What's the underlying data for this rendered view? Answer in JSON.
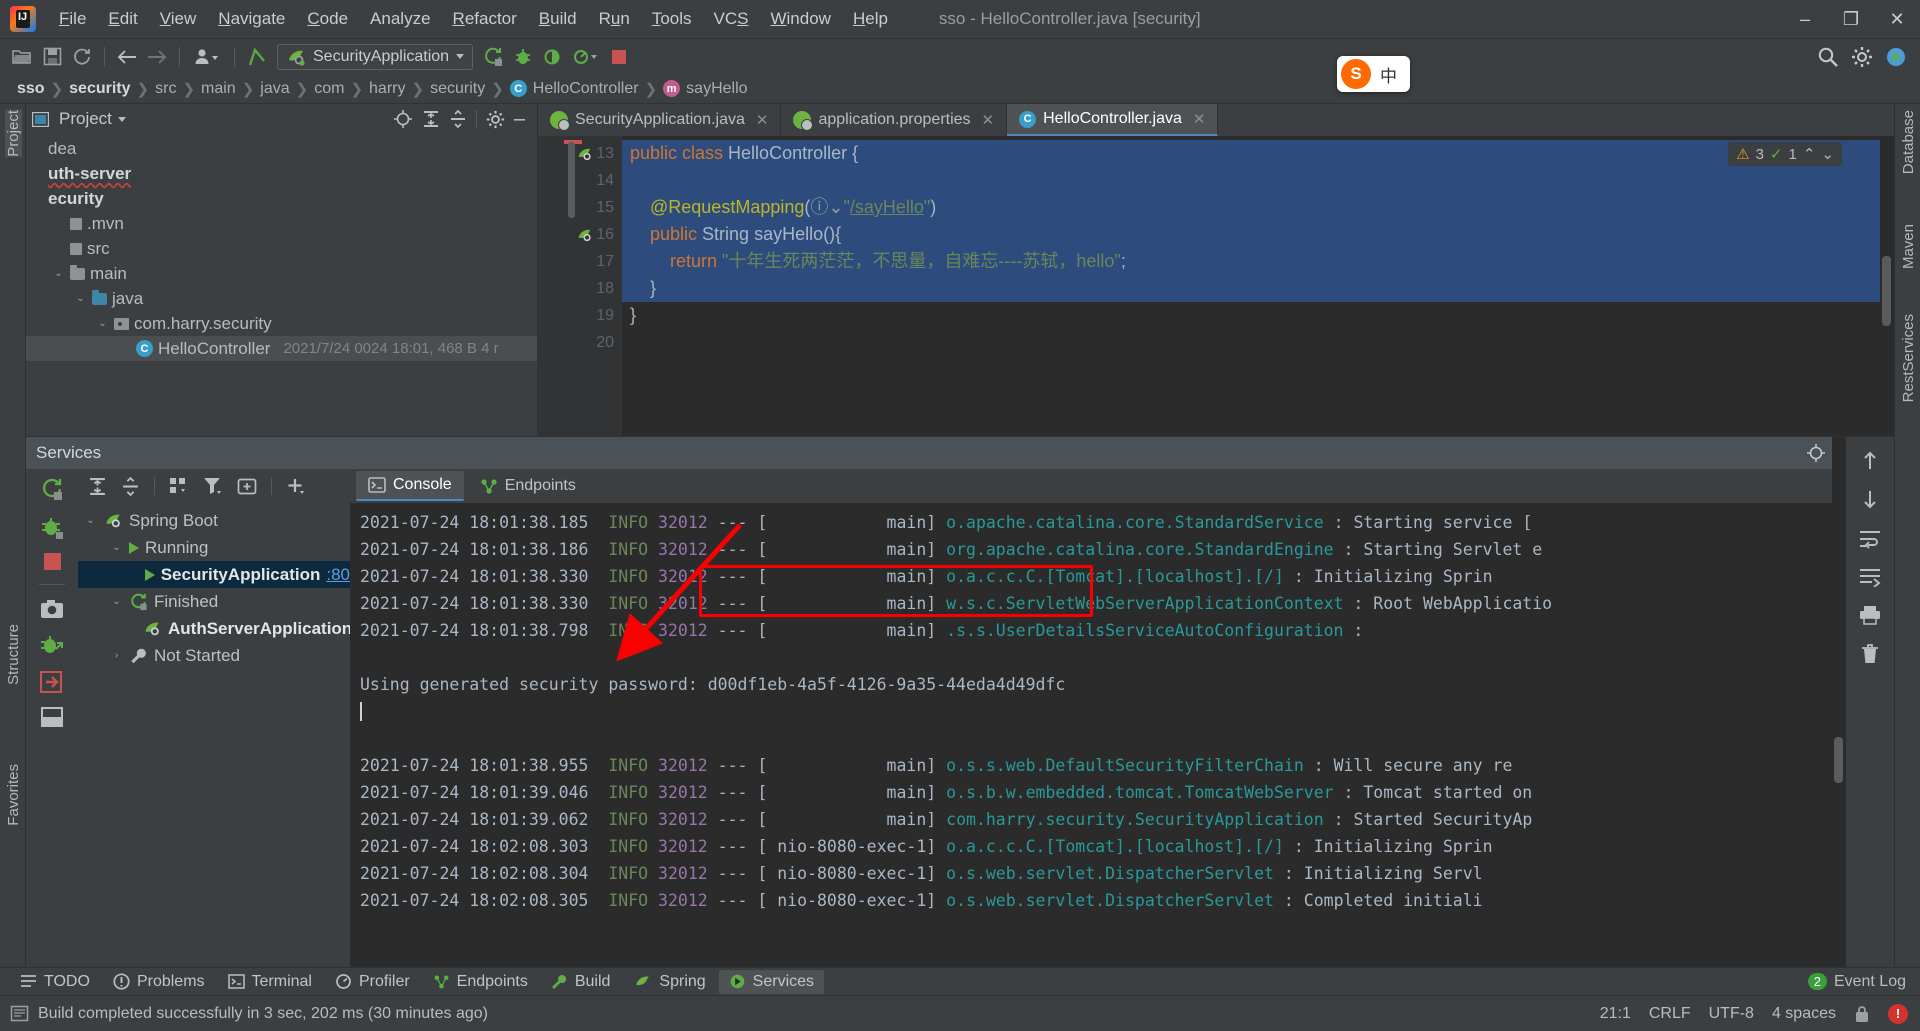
{
  "window": {
    "title": "sso - HelloController.java [security]",
    "minimize": "–",
    "maximize": "❐",
    "close": "✕"
  },
  "menu": [
    {
      "label": "File",
      "mn": "F"
    },
    {
      "label": "Edit",
      "mn": "E"
    },
    {
      "label": "View",
      "mn": "V"
    },
    {
      "label": "Navigate",
      "mn": "N"
    },
    {
      "label": "Code",
      "mn": "C"
    },
    {
      "label": "Analyze",
      "mn": ""
    },
    {
      "label": "Refactor",
      "mn": "R"
    },
    {
      "label": "Build",
      "mn": "B"
    },
    {
      "label": "Run",
      "mn": "u"
    },
    {
      "label": "Tools",
      "mn": "T"
    },
    {
      "label": "VCS",
      "mn": "S"
    },
    {
      "label": "Window",
      "mn": "W"
    },
    {
      "label": "Help",
      "mn": "H"
    }
  ],
  "toolbar": {
    "run_config": "SecurityApplication",
    "icons": [
      "open-folder-icon",
      "save-icon",
      "sync-icon",
      "back-arrow-icon",
      "forward-arrow-icon",
      "user-icon",
      "update-project-icon",
      "run-icon",
      "debug-icon",
      "run-with-coverage-icon",
      "profile-icon",
      "stop-icon"
    ],
    "right_icons": [
      "search-icon",
      "settings-icon",
      "run-dashboard-icon"
    ]
  },
  "breadcrumb": [
    {
      "label": "sso",
      "bold": true,
      "icon": null
    },
    {
      "label": "security",
      "bold": true,
      "icon": null
    },
    {
      "label": "src",
      "bold": false,
      "icon": null
    },
    {
      "label": "main",
      "bold": false,
      "icon": null
    },
    {
      "label": "java",
      "bold": false,
      "icon": null
    },
    {
      "label": "com",
      "bold": false,
      "icon": null
    },
    {
      "label": "harry",
      "bold": false,
      "icon": null
    },
    {
      "label": "security",
      "bold": false,
      "icon": null
    },
    {
      "label": "HelloController",
      "bold": false,
      "icon": "class-icon"
    },
    {
      "label": "sayHello",
      "bold": false,
      "icon": "method-icon"
    }
  ],
  "ime": {
    "logo": "S",
    "label": "中"
  },
  "left_strip": [
    "Project",
    "Structure",
    "Favorites"
  ],
  "right_strip": [
    "Database",
    "Maven",
    "RestServices"
  ],
  "project": {
    "title": "Project",
    "tree": [
      {
        "label": "dea",
        "indent": 0,
        "icon": "none",
        "bold": false,
        "arrow": "",
        "info": ""
      },
      {
        "label": "uth-server",
        "indent": 0,
        "icon": "none",
        "bold": true,
        "arrow": "",
        "info": "",
        "squiggle": true
      },
      {
        "label": "ecurity",
        "indent": 0,
        "icon": "none",
        "bold": true,
        "arrow": "",
        "info": ""
      },
      {
        "label": ".mvn",
        "indent": 1,
        "icon": "square",
        "bold": false,
        "arrow": "",
        "info": ""
      },
      {
        "label": "src",
        "indent": 1,
        "icon": "square",
        "bold": false,
        "arrow": "",
        "info": ""
      },
      {
        "label": "main",
        "indent": 1,
        "icon": "folder",
        "bold": false,
        "arrow": "v",
        "info": ""
      },
      {
        "label": "java",
        "indent": 2,
        "icon": "folder-blue",
        "bold": false,
        "arrow": "v",
        "info": ""
      },
      {
        "label": "com.harry.security",
        "indent": 3,
        "icon": "package",
        "bold": false,
        "arrow": "v",
        "info": ""
      },
      {
        "label": "HelloController",
        "indent": 4,
        "icon": "class",
        "bold": false,
        "arrow": "",
        "info": "2021/7/24 0024 18:01, 468 B 4 r",
        "selected": true
      }
    ]
  },
  "editor": {
    "tabs": [
      {
        "label": "SecurityApplication.java",
        "icon": "spring-boot-icon",
        "active": false,
        "close": "✕"
      },
      {
        "label": "application.properties",
        "icon": "spring-leaf-icon",
        "active": false,
        "close": "✕"
      },
      {
        "label": "HelloController.java",
        "icon": "class-icon",
        "active": true,
        "close": "✕"
      }
    ],
    "inspection": {
      "warnings": "3",
      "checks": "1",
      "up": "⌃",
      "down": "⌄"
    },
    "lines": [
      {
        "num": "13",
        "gutter_icon": "spring-endpoint-icon",
        "highlight": true,
        "tokens": [
          {
            "t": "public ",
            "c": "k"
          },
          {
            "t": "class ",
            "c": "k"
          },
          {
            "t": "HelloController ",
            "c": "cls"
          },
          {
            "t": "{",
            "c": "punc"
          }
        ]
      },
      {
        "num": "14",
        "gutter_icon": "",
        "highlight": true,
        "tokens": []
      },
      {
        "num": "15",
        "gutter_icon": "",
        "highlight": true,
        "tokens": [
          {
            "t": "    @RequestMapping",
            "c": "ann"
          },
          {
            "t": "(",
            "c": "punc"
          },
          {
            "t": "ⓘ⌄",
            "c": "icon"
          },
          {
            "t": "\"",
            "c": "str"
          },
          {
            "t": "/sayHello",
            "c": "str-ul"
          },
          {
            "t": "\"",
            "c": "str"
          },
          {
            "t": ")",
            "c": "punc"
          }
        ]
      },
      {
        "num": "16",
        "gutter_icon": "spring-mapping-icon",
        "highlight": true,
        "tokens": [
          {
            "t": "    public ",
            "c": "k"
          },
          {
            "t": "String ",
            "c": "cls"
          },
          {
            "t": "sayHello",
            "c": "cls"
          },
          {
            "t": "(){",
            "c": "punc"
          }
        ]
      },
      {
        "num": "17",
        "gutter_icon": "",
        "highlight": true,
        "tokens": [
          {
            "t": "        return ",
            "c": "k"
          },
          {
            "t": "\"十年生死两茫茫，不思量，自难忘----苏轼，hello\"",
            "c": "str"
          },
          {
            "t": ";",
            "c": "punc"
          }
        ]
      },
      {
        "num": "18",
        "gutter_icon": "",
        "highlight": true,
        "tokens": [
          {
            "t": "    }",
            "c": "punc"
          }
        ]
      },
      {
        "num": "19",
        "gutter_icon": "",
        "highlight": false,
        "tokens": [
          {
            "t": "}",
            "c": "punc"
          }
        ]
      },
      {
        "num": "20",
        "gutter_icon": "",
        "highlight": false,
        "tokens": []
      }
    ]
  },
  "services": {
    "title": "Services",
    "tree": [
      {
        "label": "Spring Boot",
        "indent": 0,
        "arrow": "v",
        "icon": "spring-boot-icon",
        "bold": false
      },
      {
        "label": "Running",
        "indent": 1,
        "arrow": "v",
        "icon": "run-icon",
        "bold": false
      },
      {
        "label": "SecurityApplication",
        "indent": 2,
        "arrow": "",
        "icon": "run-icon",
        "bold": true,
        "port": ":80",
        "selected": true
      },
      {
        "label": "Finished",
        "indent": 1,
        "arrow": "v",
        "icon": "rerun-icon",
        "bold": false
      },
      {
        "label": "AuthServerApplication",
        "indent": 2,
        "arrow": "",
        "icon": "spring-boot-icon",
        "bold": true
      },
      {
        "label": "Not Started",
        "indent": 1,
        "arrow": ">",
        "icon": "wrench-icon",
        "bold": false
      }
    ],
    "left_icons": [
      "rerun-icon",
      "debug-icon",
      "stop-icon",
      "camera-icon",
      "attach-debugger-icon",
      "export-icon",
      "layout-icon"
    ],
    "toolbar_icons": [
      "expand-all-icon",
      "collapse-all-icon",
      "group-icon",
      "filter-icon",
      "add-tab-icon",
      "add-icon"
    ],
    "console_tabs": [
      {
        "label": "Console",
        "icon": "console-icon",
        "active": true
      },
      {
        "label": "Endpoints",
        "icon": "endpoints-icon",
        "active": false
      }
    ],
    "console_right_icons": [
      "scroll-up-icon",
      "scroll-down-icon",
      "soft-wrap-icon",
      "scroll-to-end-icon",
      "print-icon",
      "clear-all-icon"
    ],
    "log": [
      {
        "ts": "2021-07-24 18:01:38.185",
        "level": "INFO",
        "pid": "32012",
        "thread": "main",
        "logger": "o.apache.catalina.core.StandardService",
        "msg": ": Starting service ["
      },
      {
        "ts": "2021-07-24 18:01:38.186",
        "level": "INFO",
        "pid": "32012",
        "thread": "main",
        "logger": "org.apache.catalina.core.StandardEngine",
        "msg": ": Starting Servlet e"
      },
      {
        "ts": "2021-07-24 18:01:38.330",
        "level": "INFO",
        "pid": "32012",
        "thread": "main",
        "logger": "o.a.c.c.C.[Tomcat].[localhost].[/]",
        "msg": ": Initializing Sprin"
      },
      {
        "ts": "2021-07-24 18:01:38.330",
        "level": "INFO",
        "pid": "32012",
        "thread": "main",
        "logger": "w.s.c.ServletWebServerApplicationContext",
        "msg": ": Root WebApplicatio"
      },
      {
        "ts": "2021-07-24 18:01:38.798",
        "level": "INFO",
        "pid": "32012",
        "thread": "main",
        "logger": ".s.s.UserDetailsServiceAutoConfiguration",
        "msg": ":"
      },
      {
        "blank": true
      },
      {
        "plain": "Using generated security password: ",
        "highlight": "d00df1eb-4a5f-4126-9a35-44eda4d49dfc"
      },
      {
        "caret": true
      },
      {
        "blank": true
      },
      {
        "ts": "2021-07-24 18:01:38.955",
        "level": "INFO",
        "pid": "32012",
        "thread": "main",
        "logger": "o.s.s.web.DefaultSecurityFilterChain",
        "msg": ": Will secure any re"
      },
      {
        "ts": "2021-07-24 18:01:39.046",
        "level": "INFO",
        "pid": "32012",
        "thread": "main",
        "logger": "o.s.b.w.embedded.tomcat.TomcatWebServer",
        "msg": ": Tomcat started on"
      },
      {
        "ts": "2021-07-24 18:01:39.062",
        "level": "INFO",
        "pid": "32012",
        "thread": "main",
        "logger": "com.harry.security.SecurityApplication",
        "msg": ": Started SecurityAp"
      },
      {
        "ts": "2021-07-24 18:02:08.303",
        "level": "INFO",
        "pid": "32012",
        "thread": "nio-8080-exec-1",
        "logger": "o.a.c.c.C.[Tomcat].[localhost].[/]",
        "msg": ": Initializing Sprin"
      },
      {
        "ts": "2021-07-24 18:02:08.304",
        "level": "INFO",
        "pid": "32012",
        "thread": "nio-8080-exec-1",
        "logger": "o.s.web.servlet.DispatcherServlet",
        "msg": ": Initializing Servl"
      },
      {
        "ts": "2021-07-24 18:02:08.305",
        "level": "INFO",
        "pid": "32012",
        "thread": "nio-8080-exec-1",
        "logger": "o.s.web.servlet.DispatcherServlet",
        "msg": ": Completed initiali"
      }
    ]
  },
  "toolwindow_bar": [
    {
      "label": "TODO",
      "icon": "todo-icon",
      "active": false
    },
    {
      "label": "Problems",
      "icon": "problems-icon",
      "active": false
    },
    {
      "label": "Terminal",
      "icon": "terminal-icon",
      "active": false
    },
    {
      "label": "Profiler",
      "icon": "profiler-icon",
      "active": false
    },
    {
      "label": "Endpoints",
      "icon": "endpoints-icon",
      "active": false
    },
    {
      "label": "Build",
      "icon": "build-icon",
      "active": false
    },
    {
      "label": "Spring",
      "icon": "spring-icon",
      "active": false
    },
    {
      "label": "Services",
      "icon": "services-icon",
      "active": true
    }
  ],
  "event_log": {
    "label": "Event Log",
    "count": "2"
  },
  "status": {
    "message": "Build completed successfully in 3 sec, 202 ms (30 minutes ago)",
    "caret": "21:1",
    "line_sep": "CRLF",
    "encoding": "UTF-8",
    "indent": "4 spaces",
    "lock_icon": "lock-icon",
    "error_count": "!"
  },
  "colors": {
    "accent": "#4a88c7",
    "selection": "#2d4b7d",
    "annotation_red": "#fb0000",
    "string_green": "#6a8759",
    "keyword_orange": "#cc7832",
    "panel_bg": "#3c3f41",
    "editor_bg": "#2b2b2b"
  }
}
